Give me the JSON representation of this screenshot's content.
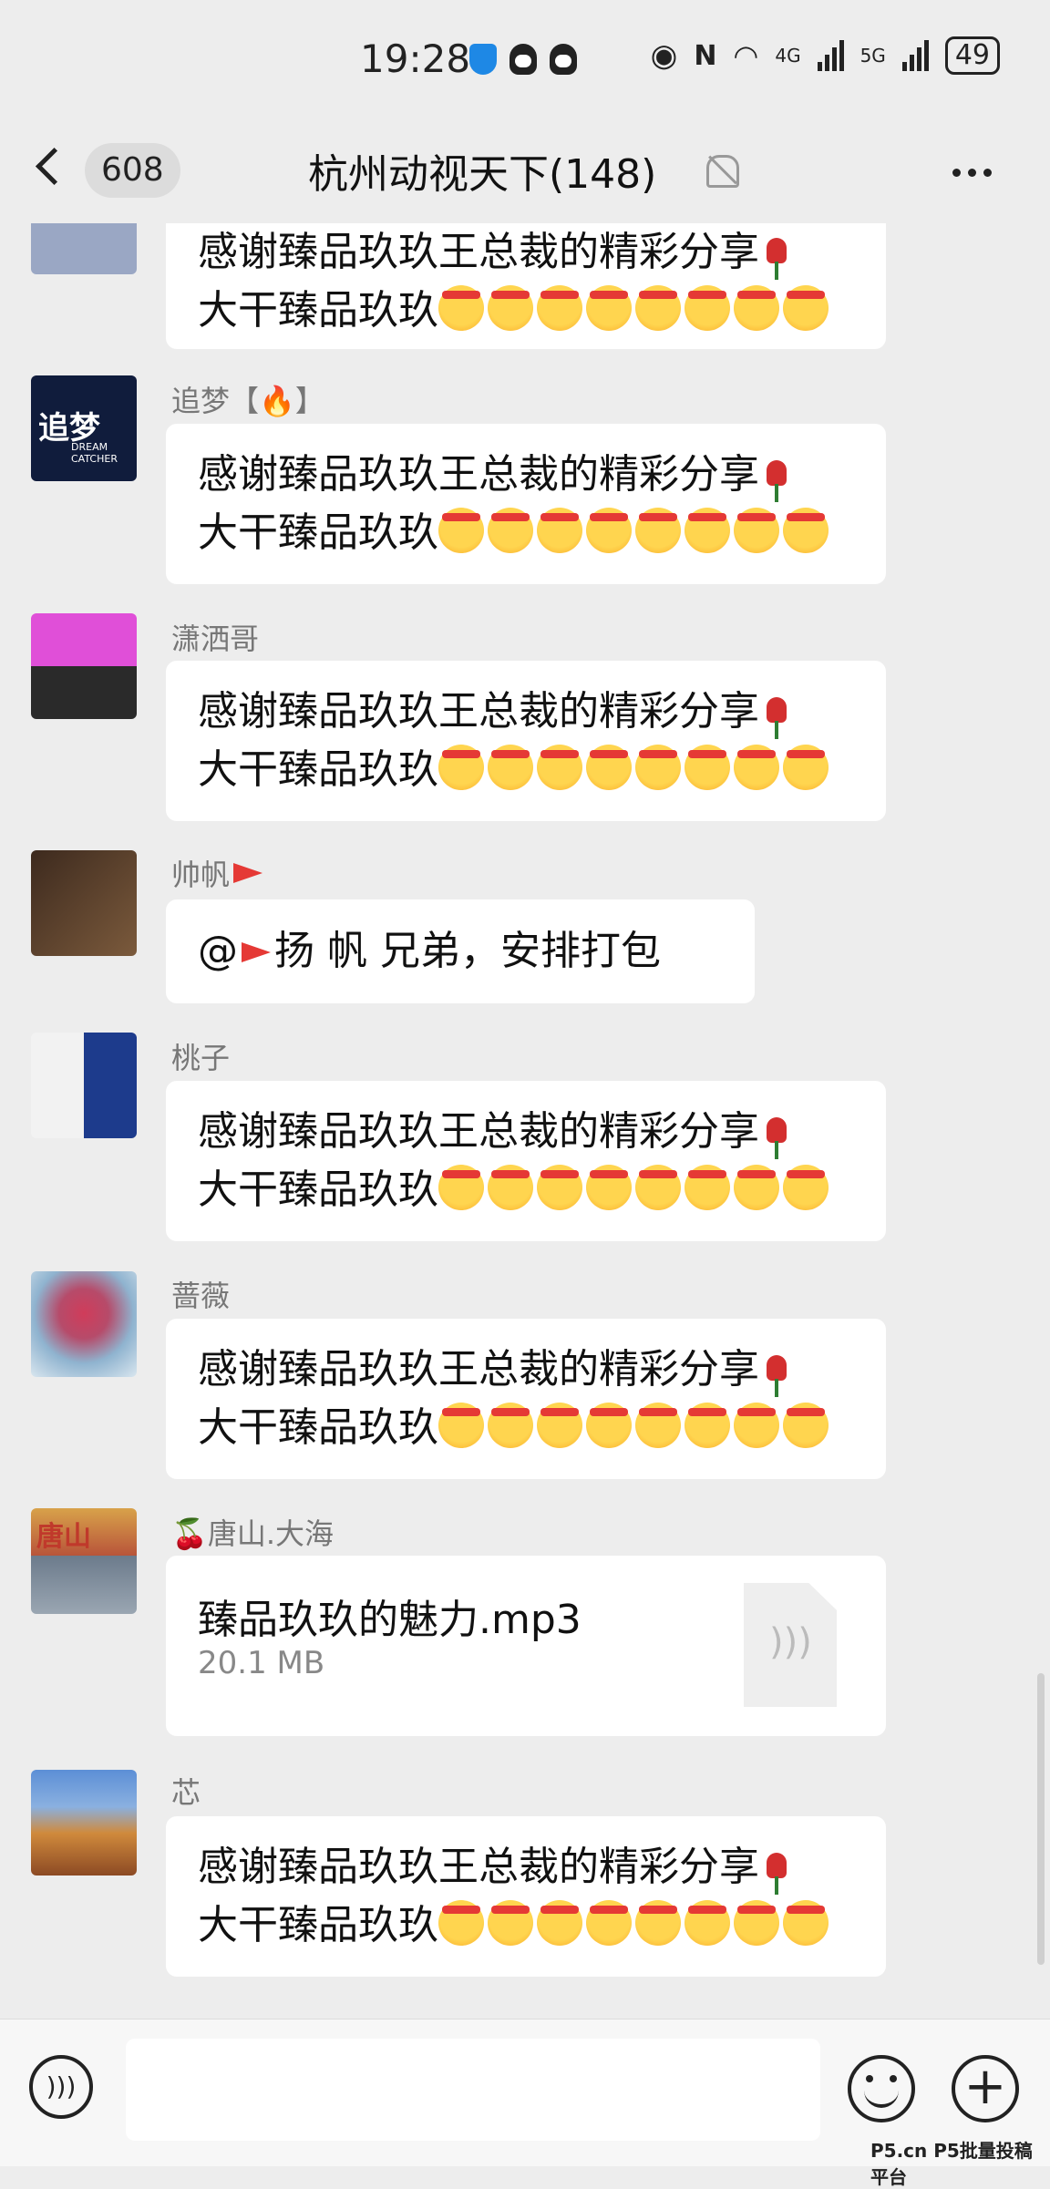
{
  "status_bar": {
    "time": "19:28",
    "network_a": "4G",
    "network_b": "5G",
    "battery": "49"
  },
  "header": {
    "unread_count": "608",
    "title": "杭州动视天下(148)"
  },
  "messages": [
    {
      "sender": "",
      "line1": "感谢臻品玖玖王总裁的精彩分享",
      "line2": "大干臻品玖玖"
    },
    {
      "sender": "追梦【🔥】",
      "line1": "感谢臻品玖玖王总裁的精彩分享",
      "line2": "大干臻品玖玖"
    },
    {
      "sender": "潇洒哥",
      "line1": "感谢臻品玖玖王总裁的精彩分享",
      "line2": "大干臻品玖玖"
    },
    {
      "sender": "帅帆",
      "line1": "@",
      "line2": "扬 帆  兄弟，安排打包"
    },
    {
      "sender": "桃子",
      "line1": "感谢臻品玖玖王总裁的精彩分享",
      "line2": "大干臻品玖玖"
    },
    {
      "sender": "蔷薇",
      "line1": "感谢臻品玖玖王总裁的精彩分享",
      "line2": "大干臻品玖玖"
    },
    {
      "sender": "🍒唐山.大海",
      "file_name": "臻品玖玖的魅力.mp3",
      "file_size": "20.1 MB"
    },
    {
      "sender": "芯",
      "line1": "感谢臻品玖玖王总裁的精彩分享",
      "line2": "大干臻品玖玖"
    }
  ],
  "avatar_texts": {
    "dream_avatar": "追梦",
    "dream_sub": "DREAM CATCHER",
    "tangshan_avatar": "唐山"
  },
  "watermark": "P5.cn P5批量投稿平台",
  "colors": {
    "bubble": "#ffffff",
    "background": "#ededed",
    "sender_text": "#777777"
  }
}
